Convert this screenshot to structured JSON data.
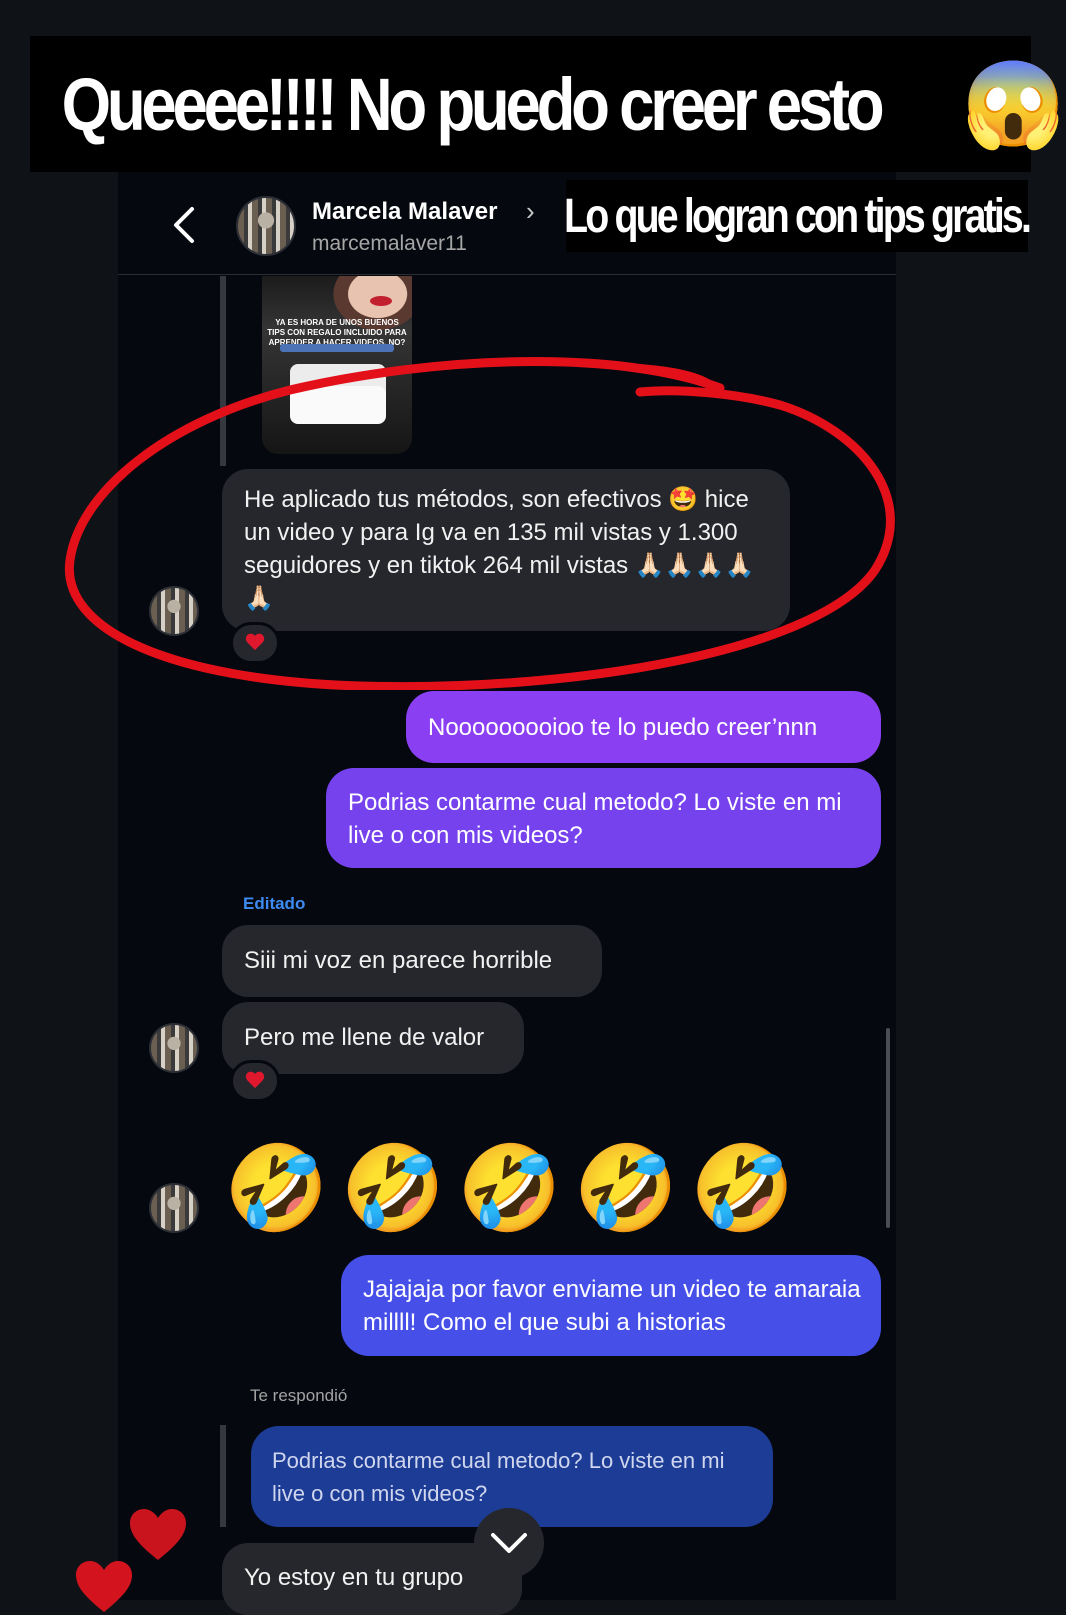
{
  "banner": {
    "text": "Queeee!!!! No puedo creer esto",
    "emoji": "😱"
  },
  "sticker_caption": "Lo que logran con tips gratis.",
  "header": {
    "name": "Marcela Malaver",
    "chevron": "›",
    "handle": "marcemalaver11"
  },
  "story_thumb": {
    "caption": "Ya es hora de unos buenos tips con regalo incluido para aprender a hacer videos, no?"
  },
  "messages": {
    "m1": "He aplicado tus métodos, son efectivos 🤩 hice un video y para Ig va en 135 mil vistas y 1.300 seguidores y en tiktok 264 mil vistas 🙏🏻🙏🏻🙏🏻🙏🏻🙏🏻",
    "m2": "Nooooooooioo te lo puedo creer’nnn",
    "m3": "Podrias contarme cual metodo? Lo viste en mi live o con mis videos?",
    "edited_label": "Editado",
    "m4": "Siii mi voz en parece horrible",
    "m5": "Pero me llene de valor",
    "m6": "🤣🤣🤣🤣🤣",
    "m7": "Jajajaja por favor enviame un video te amaraia millll! Como el que subi a historias",
    "reply_label": "Te respondió",
    "m8_quoted": "Podrias contarme cual metodo? Lo viste en mi live o con mis videos?",
    "m9": "Yo estoy en tu grupo"
  },
  "colors": {
    "outgoing_purple": "#7b3cf0",
    "outgoing_blue": "#4a56e6",
    "quoted_blue": "#1e3d97",
    "annotation_red": "#e3101a",
    "reaction_heart": "#e0182d"
  }
}
